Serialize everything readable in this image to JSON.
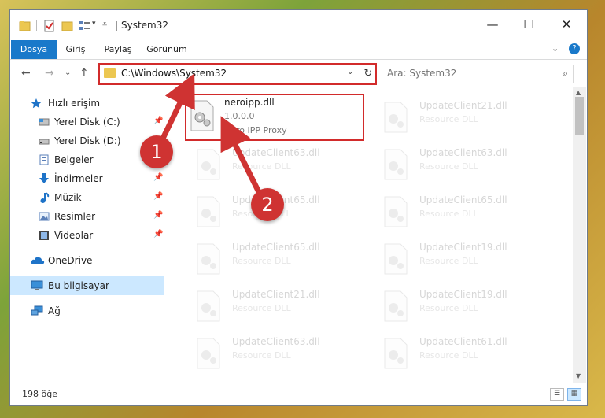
{
  "window": {
    "title": "System32",
    "minimize_glyph": "—",
    "maximize_glyph": "☐",
    "close_glyph": "✕"
  },
  "ribbon": {
    "tabs": [
      {
        "label": "Dosya"
      },
      {
        "label": "Giriş"
      },
      {
        "label": "Paylaş"
      },
      {
        "label": "Görünüm"
      }
    ],
    "expand_glyph": "⌄",
    "help_glyph": "?"
  },
  "address": {
    "path": "C:\\Windows\\System32",
    "back_glyph": "←",
    "forward_glyph": "→",
    "recent_glyph": "⌄",
    "up_glyph": "↑",
    "dropdown_glyph": "⌄",
    "refresh_glyph": "↻"
  },
  "search": {
    "placeholder": "Ara: System32",
    "icon": "magnifier-icon"
  },
  "nav": {
    "items": [
      {
        "label": "Hızlı erişim",
        "icon": "star-icon"
      },
      {
        "label": "Yerel Disk (C:)",
        "icon": "drive-icon"
      },
      {
        "label": "Yerel Disk (D:)",
        "icon": "drive-icon"
      },
      {
        "label": "Belgeler",
        "icon": "documents-icon"
      },
      {
        "label": "İndirmeler",
        "icon": "download-icon"
      },
      {
        "label": "Müzik",
        "icon": "music-icon"
      },
      {
        "label": "Resimler",
        "icon": "pictures-icon"
      },
      {
        "label": "Videolar",
        "icon": "video-icon"
      },
      {
        "label": "OneDrive",
        "icon": "cloud-icon"
      },
      {
        "label": "Bu bilgisayar",
        "icon": "computer-icon"
      },
      {
        "label": "Ağ",
        "icon": "network-icon"
      }
    ],
    "pin_glyph": "📌"
  },
  "files": {
    "highlighted": {
      "name": "neroipp.dll",
      "version": "1.0.0.0",
      "description": "Nero IPP Proxy"
    },
    "left_column": [
      {
        "name": "UpdateClient63.dll",
        "type": "Resource DLL"
      },
      {
        "name": "UpdateClient65.dll",
        "type": "Resource DLL"
      },
      {
        "name": "UpdateClient65.dll",
        "type": "Resource DLL"
      },
      {
        "name": "UpdateClient21.dll",
        "type": "Resource DLL"
      },
      {
        "name": "UpdateClient63.dll",
        "type": "Resource DLL"
      }
    ],
    "right_column": [
      {
        "name": "UpdateClient21.dll",
        "type": "Resource DLL"
      },
      {
        "name": "UpdateClient63.dll",
        "type": "Resource DLL"
      },
      {
        "name": "UpdateClient65.dll",
        "type": "Resource DLL"
      },
      {
        "name": "UpdateClient19.dll",
        "type": "Resource DLL"
      },
      {
        "name": "UpdateClient19.dll",
        "type": "Resource DLL"
      },
      {
        "name": "UpdateClient61.dll",
        "type": "Resource DLL"
      }
    ]
  },
  "status": {
    "item_count": "198 öğe"
  },
  "callouts": [
    {
      "label": "1"
    },
    {
      "label": "2"
    }
  ],
  "colors": {
    "accent": "#1979ca",
    "highlight_border": "#d22b2b",
    "selection": "#cce8ff",
    "callout": "#cf3332"
  }
}
